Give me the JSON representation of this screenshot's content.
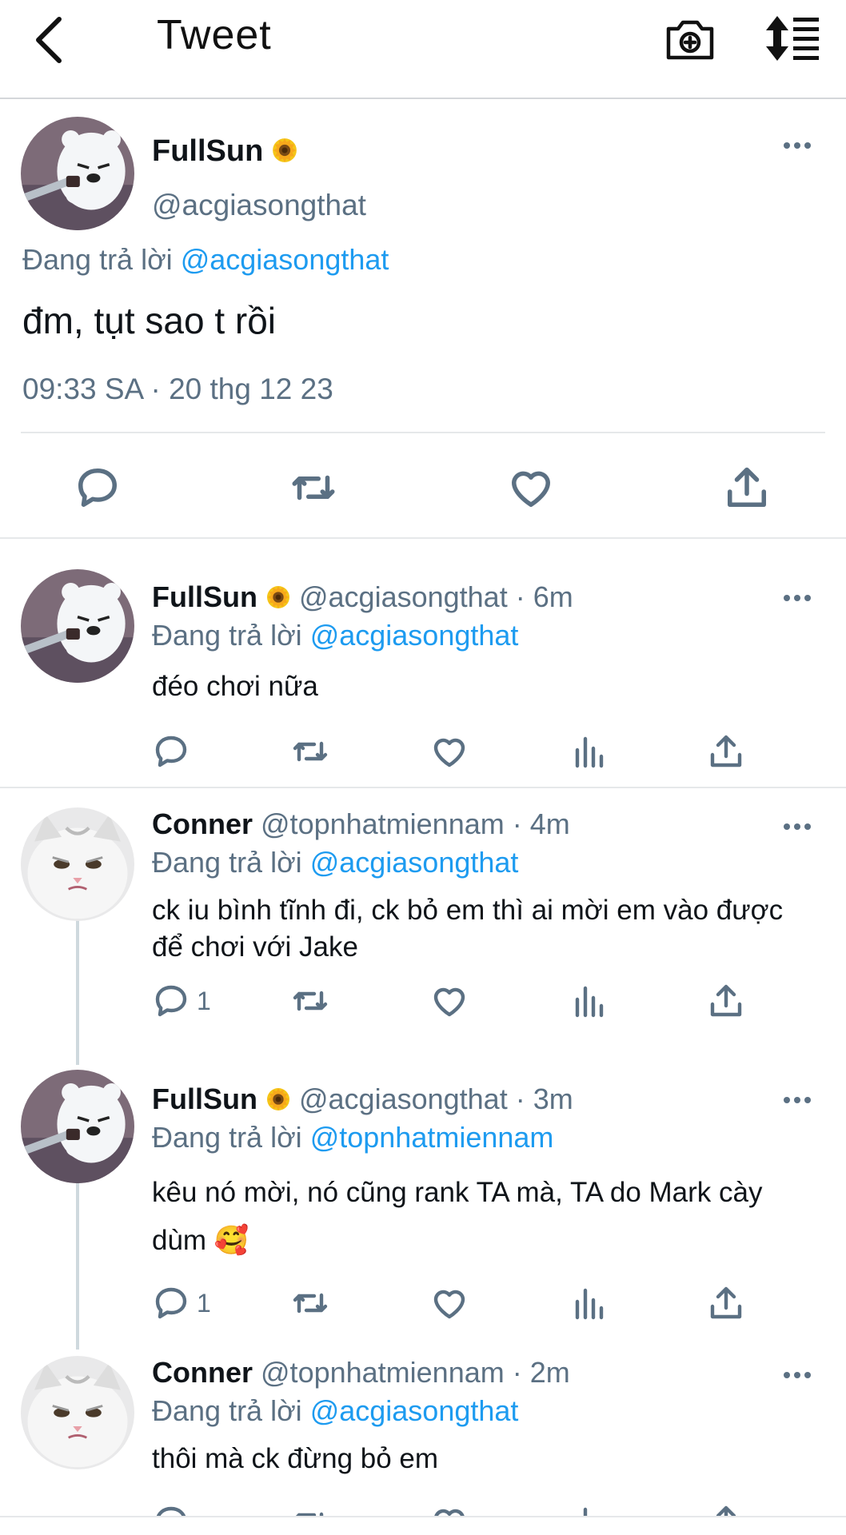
{
  "header": {
    "title": "Tweet"
  },
  "main_tweet": {
    "name": "FullSun",
    "handle": "@acgiasongthat",
    "reply_prefix": "Đang trả lời ",
    "reply_to": "@acgiasongthat",
    "text": "đm, tụt sao t rồi",
    "timestamp": "09:33 SA · 20 thg 12 23"
  },
  "replies": [
    {
      "name": "FullSun",
      "handle": "@acgiasongthat · 6m",
      "reply_prefix": "Đang trả lời ",
      "reply_to": "@acgiasongthat",
      "text": "đéo chơi nữa",
      "reply_count": ""
    },
    {
      "name": "Conner",
      "handle": "@topnhatmiennam · 4m",
      "reply_prefix": "Đang trả lời ",
      "reply_to": "@acgiasongthat",
      "text": "ck iu bình tĩnh đi, ck bỏ em thì ai mời em vào được để chơi với Jake",
      "reply_count": "1"
    },
    {
      "name": "FullSun",
      "handle": "@acgiasongthat · 3m",
      "reply_prefix": "Đang trả lời ",
      "reply_to": "@topnhatmiennam",
      "text": "kêu nó mời, nó cũng rank TA mà, TA do Mark cày dùm 🥰",
      "reply_count": "1"
    },
    {
      "name": "Conner",
      "handle": "@topnhatmiennam · 2m",
      "reply_prefix": "Đang trả lời ",
      "reply_to": "@acgiasongthat",
      "text": "thôi mà ck đừng bỏ em",
      "reply_count": ""
    }
  ],
  "colors": {
    "link": "#1d9bf0",
    "secondary": "#5b7083",
    "text": "#0f1419"
  }
}
